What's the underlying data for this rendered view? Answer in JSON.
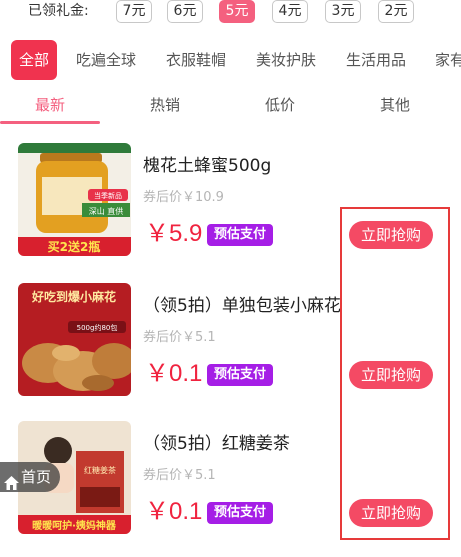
{
  "coupons": {
    "label": "已领礼金:",
    "options": [
      "7元",
      "6元",
      "5元",
      "4元",
      "3元",
      "2元"
    ],
    "selected": "5元"
  },
  "categories": [
    "全部",
    "吃遍全球",
    "衣服鞋帽",
    "美妆护肤",
    "生活用品",
    "家有"
  ],
  "sort_tabs": [
    "最新",
    "热销",
    "低价",
    "其他"
  ],
  "products": [
    {
      "title": "槐花土蜂蜜500g",
      "before_price": "券后价￥10.9",
      "price": "￥5.9",
      "badge": "预估支付",
      "buy": "立即抢购",
      "thumb_banner": "买2送2瓶",
      "thumb_tag": "深山 直供",
      "thumb_top": "当季新品"
    },
    {
      "title": "（领5拍）单独包装小麻花",
      "before_price": "券后价￥5.1",
      "price": "￥0.1",
      "badge": "预估支付",
      "buy": "立即抢购",
      "thumb_banner": "好吃到爆小麻花",
      "thumb_tag": "500g约80包"
    },
    {
      "title": "（领5拍）红糖姜茶",
      "before_price": "券后价￥5.1",
      "price": "￥0.1",
      "badge": "预估支付",
      "buy": "立即抢购",
      "thumb_banner": "暖暖呵护·姨妈神器",
      "thumb_tag": "红糖姜茶"
    }
  ],
  "home_button": "首页",
  "colors": {
    "accent_pink": "#f4607f",
    "category_active": "#f0334f",
    "price_red": "#f0233f",
    "badge_purple": "#a51ee6",
    "buy_button": "#f44a64",
    "highlight_box": "#e63a3a"
  }
}
